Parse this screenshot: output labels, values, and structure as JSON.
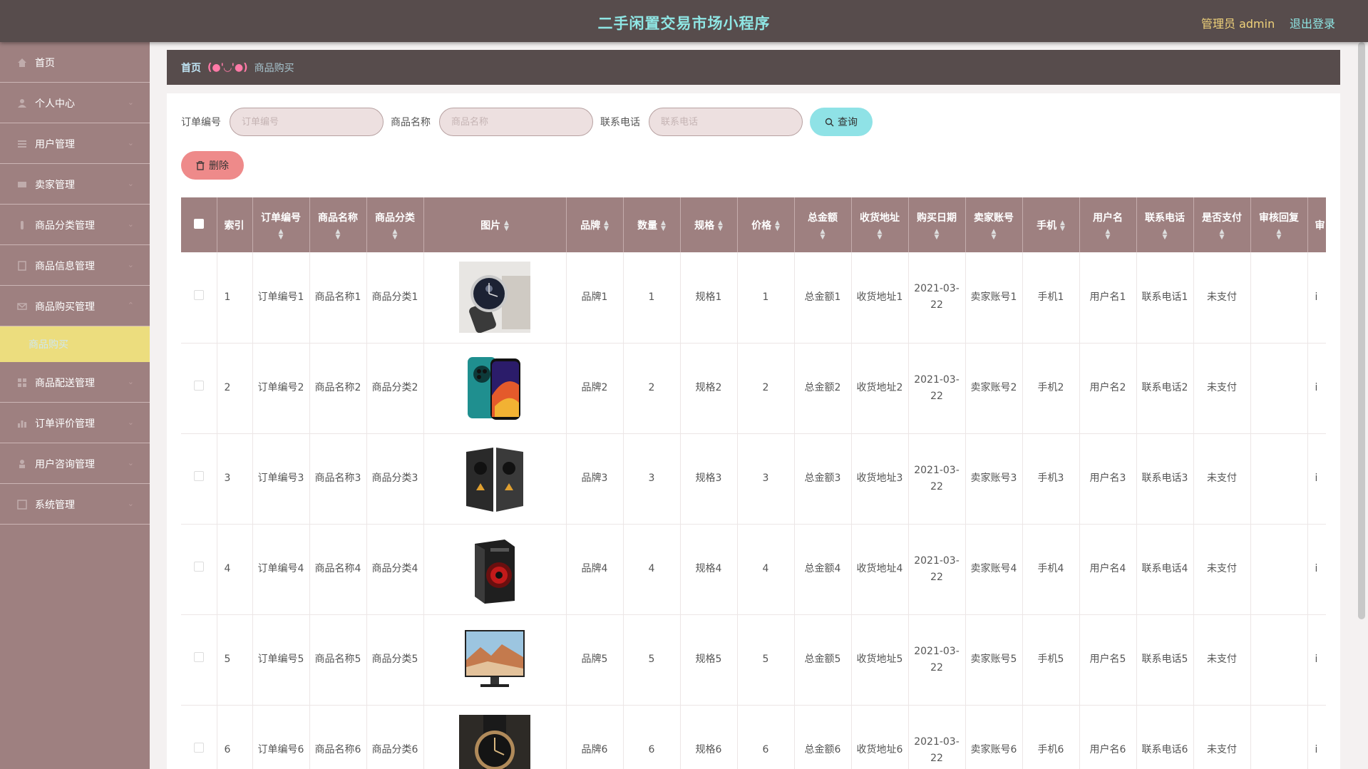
{
  "header": {
    "app_title": "二手闲置交易市场小程序",
    "admin_label": "管理员 admin",
    "logout_label": "退出登录"
  },
  "sidebar": {
    "items": [
      {
        "label": "首页",
        "icon": "home-icon"
      },
      {
        "label": "个人中心",
        "icon": "user-icon"
      },
      {
        "label": "用户管理",
        "icon": "list-icon"
      },
      {
        "label": "卖家管理",
        "icon": "card-icon"
      },
      {
        "label": "商品分类管理",
        "icon": "tag-icon"
      },
      {
        "label": "商品信息管理",
        "icon": "doc-icon"
      },
      {
        "label": "商品购买管理",
        "icon": "mail-icon"
      },
      {
        "label": "商品配送管理",
        "icon": "grid-icon"
      },
      {
        "label": "订单评价管理",
        "icon": "bar-chart-icon"
      },
      {
        "label": "用户咨询管理",
        "icon": "person-icon"
      },
      {
        "label": "系统管理",
        "icon": "settings-icon"
      }
    ],
    "active_sub": "商品购买"
  },
  "breadcrumb": {
    "home": "首页",
    "separator": "(●'◡'●)",
    "current": "商品购买"
  },
  "search": {
    "order_label": "订单编号",
    "order_placeholder": "订单编号",
    "product_label": "商品名称",
    "product_placeholder": "商品名称",
    "phone_label": "联系电话",
    "phone_placeholder": "联系电话",
    "query_label": "查询",
    "delete_label": "删除"
  },
  "table": {
    "headers": {
      "index": "索引",
      "order_no": "订单编号",
      "product_name": "商品名称",
      "category": "商品分类",
      "image": "图片",
      "brand": "品牌",
      "quantity": "数量",
      "spec": "规格",
      "price": "价格",
      "total": "总金额",
      "address": "收货地址",
      "buy_date": "购买日期",
      "seller": "卖家账号",
      "mobile": "手机",
      "username": "用户名",
      "phone": "联系电话",
      "paid": "是否支付",
      "review_reply": "审核回复",
      "review_cut": "审"
    },
    "rows": [
      {
        "index": "1",
        "order_no": "订单编号1",
        "product_name": "商品名称1",
        "category": "商品分类1",
        "image": "watch",
        "brand": "品牌1",
        "quantity": "1",
        "spec": "规格1",
        "price": "1",
        "total": "总金额1",
        "address": "收货地址1",
        "buy_date": "2021-03-22",
        "seller": "卖家账号1",
        "mobile": "手机1",
        "username": "用户名1",
        "phone": "联系电话1",
        "paid": "未支付",
        "review_reply": "",
        "review_cut": "i"
      },
      {
        "index": "2",
        "order_no": "订单编号2",
        "product_name": "商品名称2",
        "category": "商品分类2",
        "image": "phone",
        "brand": "品牌2",
        "quantity": "2",
        "spec": "规格2",
        "price": "2",
        "total": "总金额2",
        "address": "收货地址2",
        "buy_date": "2021-03-22",
        "seller": "卖家账号2",
        "mobile": "手机2",
        "username": "用户名2",
        "phone": "联系电话2",
        "paid": "未支付",
        "review_reply": "",
        "review_cut": "i"
      },
      {
        "index": "3",
        "order_no": "订单编号3",
        "product_name": "商品名称3",
        "category": "商品分类3",
        "image": "speakers",
        "brand": "品牌3",
        "quantity": "3",
        "spec": "规格3",
        "price": "3",
        "total": "总金额3",
        "address": "收货地址3",
        "buy_date": "2021-03-22",
        "seller": "卖家账号3",
        "mobile": "手机3",
        "username": "用户名3",
        "phone": "联系电话3",
        "paid": "未支付",
        "review_reply": "",
        "review_cut": "i"
      },
      {
        "index": "4",
        "order_no": "订单编号4",
        "product_name": "商品名称4",
        "category": "商品分类4",
        "image": "pc-case",
        "brand": "品牌4",
        "quantity": "4",
        "spec": "规格4",
        "price": "4",
        "total": "总金额4",
        "address": "收货地址4",
        "buy_date": "2021-03-22",
        "seller": "卖家账号4",
        "mobile": "手机4",
        "username": "用户名4",
        "phone": "联系电话4",
        "paid": "未支付",
        "review_reply": "",
        "review_cut": "i"
      },
      {
        "index": "5",
        "order_no": "订单编号5",
        "product_name": "商品名称5",
        "category": "商品分类5",
        "image": "monitor",
        "brand": "品牌5",
        "quantity": "5",
        "spec": "规格5",
        "price": "5",
        "total": "总金额5",
        "address": "收货地址5",
        "buy_date": "2021-03-22",
        "seller": "卖家账号5",
        "mobile": "手机5",
        "username": "用户名5",
        "phone": "联系电话5",
        "paid": "未支付",
        "review_reply": "",
        "review_cut": "i"
      },
      {
        "index": "6",
        "order_no": "订单编号6",
        "product_name": "商品名称6",
        "category": "商品分类6",
        "image": "watch2",
        "brand": "品牌6",
        "quantity": "6",
        "spec": "规格6",
        "price": "6",
        "total": "总金额6",
        "address": "收货地址6",
        "buy_date": "2021-03-22",
        "seller": "卖家账号6",
        "mobile": "手机6",
        "username": "用户名6",
        "phone": "联系电话6",
        "paid": "未支付",
        "review_reply": "",
        "review_cut": "i"
      }
    ]
  },
  "colors": {
    "header_bg": "#574c4c",
    "sidebar_bg": "#9e8080",
    "title": "#8fe6e4",
    "admin": "#f0d27a",
    "active_sub": "#ecdd7e",
    "query_btn": "#8fe2e6",
    "delete_btn": "#ee8a8a"
  }
}
